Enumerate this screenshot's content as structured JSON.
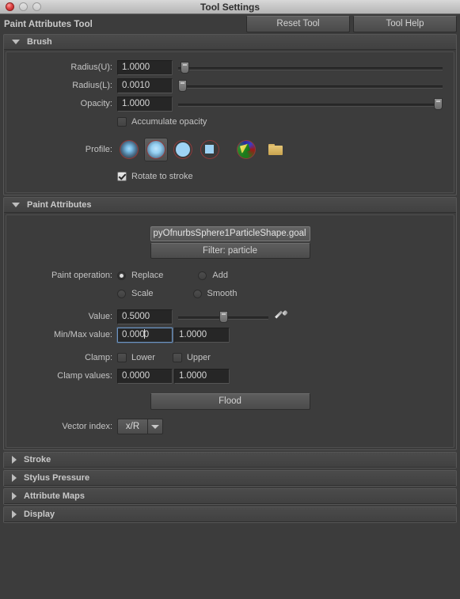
{
  "window": {
    "title": "Tool Settings",
    "buttons": {
      "close": "close",
      "minimize": "minimize",
      "zoom": "zoom"
    }
  },
  "toolbar": {
    "tool_title": "Paint Attributes Tool",
    "reset_label": "Reset Tool",
    "help_label": "Tool Help"
  },
  "brush": {
    "section_title": "Brush",
    "radius_u": {
      "label": "Radius(U):",
      "value": "1.0000",
      "slider_pct": 1
    },
    "radius_l": {
      "label": "Radius(L):",
      "value": "0.0010",
      "slider_pct": 0
    },
    "opacity": {
      "label": "Opacity:",
      "value": "1.0000",
      "slider_pct": 100
    },
    "accumulate": {
      "label": "Accumulate opacity",
      "checked": false
    },
    "profile": {
      "label": "Profile:",
      "selected_index": 1,
      "items": [
        {
          "name": "profile-soft-gaussian-icon"
        },
        {
          "name": "profile-soft-blur-icon"
        },
        {
          "name": "profile-hard-circle-icon"
        },
        {
          "name": "profile-square-icon"
        },
        {
          "name": "profile-custom-image-icon"
        }
      ],
      "browse": {
        "name": "folder-icon"
      }
    },
    "rotate_to_stroke": {
      "label": "Rotate to stroke",
      "checked": true
    }
  },
  "paint_attributes": {
    "section_title": "Paint Attributes",
    "attribute_name": "pyOfnurbsSphere1ParticleShape.goal",
    "filter_label": "Filter: particle",
    "paint_operation": {
      "label": "Paint operation:",
      "selected": "Replace",
      "options": [
        "Replace",
        "Add",
        "Scale",
        "Smooth"
      ]
    },
    "value": {
      "label": "Value:",
      "value": "0.5000",
      "slider_pct": 50
    },
    "minmax": {
      "label": "Min/Max value:",
      "min": "0.000",
      "min_tail": "0",
      "max": "1.0000",
      "focused": true
    },
    "clamp": {
      "label": "Clamp:",
      "lower_label": "Lower",
      "lower_checked": false,
      "upper_label": "Upper",
      "upper_checked": false
    },
    "clamp_values": {
      "label": "Clamp values:",
      "min": "0.0000",
      "max": "1.0000"
    },
    "flood_label": "Flood",
    "vector_index": {
      "label": "Vector index:",
      "value": "x/R"
    }
  },
  "collapsed_sections": [
    {
      "title": "Stroke"
    },
    {
      "title": "Stylus Pressure"
    },
    {
      "title": "Attribute Maps"
    },
    {
      "title": "Display"
    }
  ]
}
